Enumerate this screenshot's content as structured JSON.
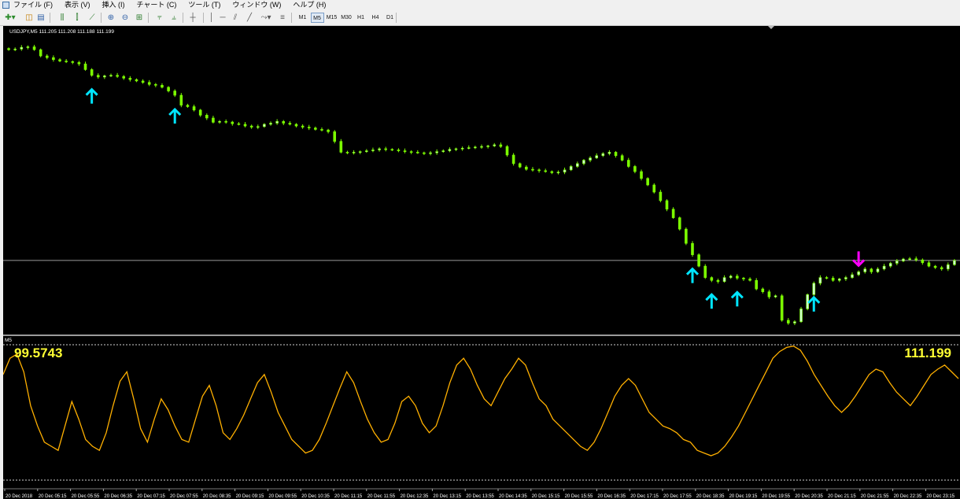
{
  "menu": {
    "items": [
      "ファイル (F)",
      "表示 (V)",
      "挿入 (I)",
      "チャート (C)",
      "ツール (T)",
      "ウィンドウ (W)",
      "ヘルプ (H)"
    ]
  },
  "toolbar": {
    "timeframes": [
      "M1",
      "M5",
      "M15",
      "M30",
      "H1",
      "H4",
      "D1"
    ],
    "active_timeframe": "M5"
  },
  "price_window": {
    "header": "USDJPY,M5  111.205 111.208 111.188 111.199",
    "horizontal_line_price": 111.199
  },
  "indicator_window": {
    "name": "M5",
    "left_value": "99.5743",
    "right_value": "111.199"
  },
  "time_axis": {
    "labels": [
      "20 Dec 2018",
      "20 Dec 05:15",
      "20 Dec 05:55",
      "20 Dec 06:35",
      "20 Dec 07:15",
      "20 Dec 07:55",
      "20 Dec 08:35",
      "20 Dec 09:15",
      "20 Dec 09:55",
      "20 Dec 10:35",
      "20 Dec 11:15",
      "20 Dec 11:55",
      "20 Dec 12:35",
      "20 Dec 13:15",
      "20 Dec 13:55",
      "20 Dec 14:35",
      "20 Dec 15:15",
      "20 Dec 15:55",
      "20 Dec 16:35",
      "20 Dec 17:15",
      "20 Dec 17:55",
      "20 Dec 18:35",
      "20 Dec 19:15",
      "20 Dec 19:55",
      "20 Dec 20:35",
      "20 Dec 21:15",
      "20 Dec 21:55",
      "20 Dec 22:35",
      "20 Dec 23:15"
    ]
  },
  "colors": {
    "background": "#000000",
    "candle": "#7CFC00",
    "candle_body": "#CCFFCC",
    "buy_arrow": "#00E5FF",
    "sell_arrow": "#FF00FF",
    "oscillator": "#FFB000",
    "indicator_text": "#FFFF33"
  },
  "chart_data": {
    "type": "candlestick",
    "closes_note": "approximate closes per bar, left to right",
    "closes": [
      112.1,
      112.102,
      112.108,
      112.11,
      112.1,
      112.078,
      112.072,
      112.065,
      112.06,
      112.058,
      112.055,
      112.05,
      112.03,
      112.01,
      112.004,
      112.008,
      112.01,
      112.006,
      112.0,
      111.995,
      111.99,
      111.985,
      111.978,
      111.975,
      111.968,
      111.955,
      111.94,
      111.905,
      111.9,
      111.888,
      111.87,
      111.86,
      111.845,
      111.848,
      111.846,
      111.84,
      111.838,
      111.832,
      111.828,
      111.83,
      111.838,
      111.842,
      111.848,
      111.842,
      111.838,
      111.832,
      111.828,
      111.825,
      111.82,
      111.818,
      111.812,
      111.778,
      111.74,
      111.738,
      111.74,
      111.742,
      111.745,
      111.748,
      111.752,
      111.75,
      111.748,
      111.745,
      111.742,
      111.74,
      111.738,
      111.735,
      111.738,
      111.742,
      111.745,
      111.75,
      111.752,
      111.754,
      111.756,
      111.758,
      111.76,
      111.762,
      111.766,
      111.76,
      111.73,
      111.7,
      111.688,
      111.68,
      111.678,
      111.675,
      111.672,
      111.668,
      111.67,
      111.678,
      111.69,
      111.7,
      111.712,
      111.72,
      111.728,
      111.735,
      111.74,
      111.728,
      111.712,
      111.69,
      111.672,
      111.648,
      111.625,
      111.6,
      111.57,
      111.54,
      111.51,
      111.47,
      111.42,
      111.38,
      111.34,
      111.3,
      111.29,
      111.286,
      111.3,
      111.305,
      111.298,
      111.295,
      111.29,
      111.26,
      111.25,
      111.232,
      111.236,
      111.15,
      111.14,
      111.145,
      111.19,
      111.24,
      111.28,
      111.3,
      111.298,
      111.29,
      111.295,
      111.3,
      111.31,
      111.32,
      111.33,
      111.32,
      111.33,
      111.34,
      111.35,
      111.358,
      111.365,
      111.366,
      111.362,
      111.352,
      111.34,
      111.335,
      111.33,
      111.345,
      111.36
    ],
    "buy_signal_bars": [
      13,
      26,
      107,
      110,
      114,
      126
    ],
    "sell_signal_bars": [
      133
    ],
    "oscillator_series": [
      78,
      90,
      93,
      80,
      55,
      40,
      28,
      25,
      22,
      40,
      58,
      45,
      30,
      25,
      22,
      35,
      55,
      73,
      80,
      60,
      38,
      28,
      45,
      60,
      52,
      40,
      30,
      28,
      45,
      62,
      70,
      55,
      35,
      30,
      38,
      48,
      60,
      72,
      78,
      65,
      50,
      40,
      30,
      25,
      20,
      22,
      30,
      42,
      55,
      68,
      80,
      72,
      58,
      45,
      35,
      28,
      30,
      42,
      58,
      62,
      55,
      42,
      35,
      40,
      55,
      72,
      85,
      90,
      82,
      70,
      60,
      55,
      65,
      75,
      82,
      90,
      85,
      72,
      60,
      55,
      45,
      40,
      35,
      30,
      25,
      22,
      28,
      38,
      50,
      62,
      70,
      75,
      70,
      60,
      50,
      45,
      40,
      38,
      35,
      30,
      28,
      22,
      20,
      18,
      20,
      25,
      32,
      40,
      50,
      60,
      70,
      80,
      90,
      95,
      98,
      99,
      96,
      88,
      78,
      70,
      62,
      55,
      50,
      55,
      62,
      70,
      78,
      82,
      80,
      72,
      65,
      60,
      55,
      62,
      70,
      78,
      82,
      85,
      80,
      75
    ],
    "oscillator_range": [
      0,
      100
    ]
  }
}
